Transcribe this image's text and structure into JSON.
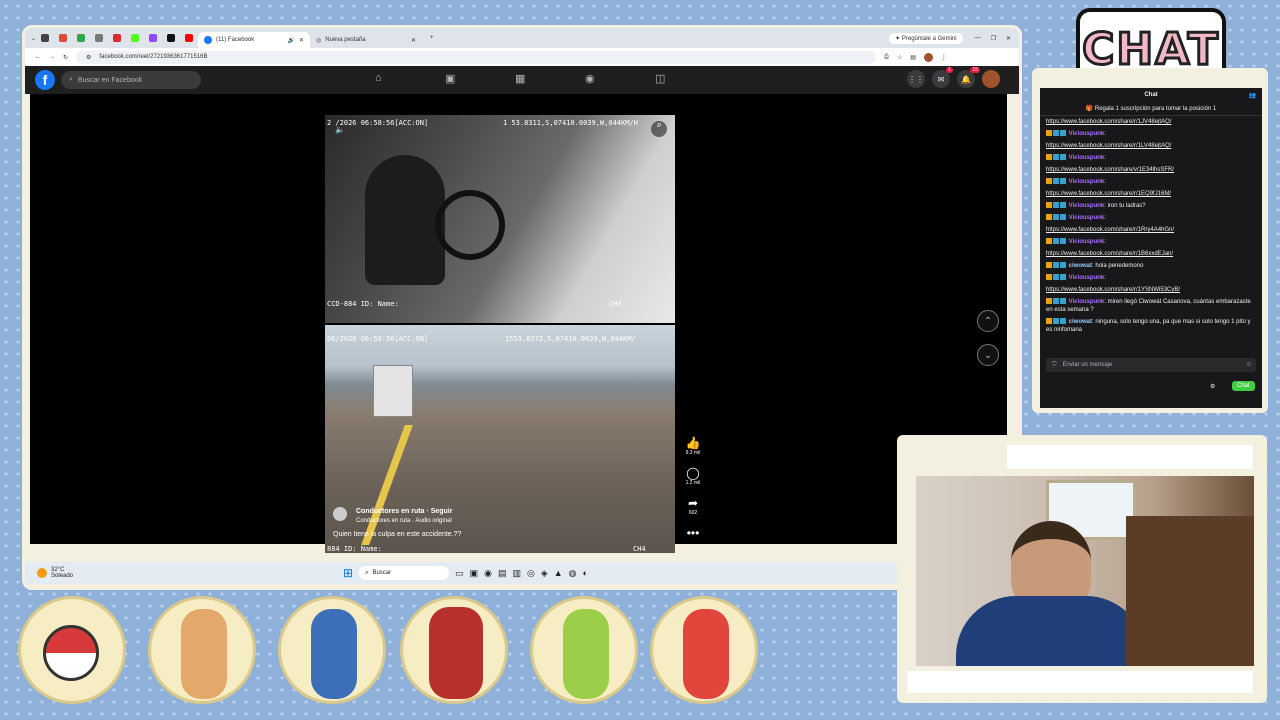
{
  "browser": {
    "active_tab_title": "(11) Facebook",
    "new_tab_title": "Nueva pestaña",
    "gemini_label": "Pregúntale a Gemini",
    "url": "facebook.com/reel/2721936361771516B"
  },
  "facebook": {
    "search_placeholder": "Buscar en Facebook",
    "messenger_badge": "1",
    "notif_badge": "15"
  },
  "reel": {
    "cam1_osd_left": "2 /2026 06:58:56[ACC:ON]",
    "cam1_osd_right": "1 53.8311,S,07410.0039,W,044KM/H",
    "cam1_bottom": "CCD-884  ID:  Name:",
    "cam1_ch": "CH3",
    "cam2_osd_left": "06/2026 06:58:56[ACC:ON]",
    "cam2_osd_right": "1553.8372,S,07410.0039,W,044KM/",
    "cam2_bottom": "884  ID:  Name:",
    "cam2_ch": "CH4",
    "channel": "Conductores en ruta",
    "follow": "Seguir",
    "audio": "Conductores en ruta · Audio original",
    "caption": "Quien  tiene la culpa en este accidente.??",
    "likes": "9.3 mil",
    "comments": "1.2 mil",
    "shares": "602",
    "more": "•••"
  },
  "taskbar": {
    "weather_temp": "32°C",
    "weather_desc": "Soleado",
    "search": "Buscar"
  },
  "chat": {
    "title": "Chat",
    "pinned": "Regala 1 suscripción para tomar la posición 1",
    "messages": [
      {
        "user": "",
        "text": "https://www.facebook.com/share/r/1JV48ejtAQ/"
      },
      {
        "user": "Viciouspunk",
        "text": ""
      },
      {
        "user": "",
        "text": "https://www.facebook.com/share/r/1LV48ejtAQ/"
      },
      {
        "user": "Viciouspunk",
        "text": ""
      },
      {
        "user": "",
        "text": "https://www.facebook.com/share/v/1E34lhsSFR/"
      },
      {
        "user": "Viciouspunk",
        "text": ""
      },
      {
        "user": "",
        "text": "https://www.facebook.com/share/r/1EQ9fJ16M/"
      },
      {
        "user": "Viciouspunk",
        "text": "iron tu ladras?"
      },
      {
        "user": "Viciouspunk",
        "text": ""
      },
      {
        "user": "",
        "text": "https://www.facebook.com/share/r/1Rry4A4hGn/"
      },
      {
        "user": "Viciouspunk",
        "text": ""
      },
      {
        "user": "",
        "text": "https://www.facebook.com/share/r/1B6xxdEJan/"
      },
      {
        "user": "ciwowat",
        "text": "hola penedemono"
      },
      {
        "user": "Viciouspunk",
        "text": ""
      },
      {
        "user": "",
        "text": "https://www.facebook.com/share/r/1YSNWi53CyB/"
      },
      {
        "user": "Viciouspunk",
        "text": "miren llegó Ciwowat Casanova, cuántas embarazaste en esta semana ?"
      },
      {
        "user": "ciwowat",
        "text": "ninguna, solo tengo una, pa que mas si solo tengo 1 pito y es ninfomana"
      }
    ],
    "input_placeholder": "Enviar un mensaje",
    "send_label": "Chat",
    "logo_text": "CHAT"
  }
}
